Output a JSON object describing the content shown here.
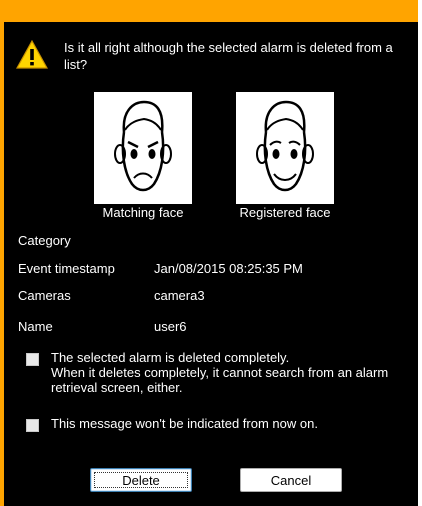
{
  "dialog": {
    "message": "Is it all right although the selected alarm is deleted from a list?"
  },
  "faces": {
    "matching_caption": "Matching face",
    "registered_caption": "Registered face"
  },
  "details": [
    {
      "label": "Category",
      "value": ""
    },
    {
      "label": "Event timestamp",
      "value": "Jan/08/2015 08:25:35 PM"
    },
    {
      "label": "Cameras",
      "value": "camera3"
    },
    {
      "label": "Name",
      "value": "user6"
    }
  ],
  "options": {
    "delete_completely": "The selected alarm is deleted completely.\nWhen it deletes completely, it cannot search from an alarm retrieval screen, either.",
    "dont_show_again": "This message won't be indicated from now on."
  },
  "buttons": {
    "delete": "Delete",
    "cancel": "Cancel"
  },
  "colors": {
    "title_bar": "#ffa400",
    "background": "#000000",
    "text": "#ffffff"
  },
  "icons": [
    "warning-icon",
    "angry-face-icon",
    "smiling-face-icon",
    "checkbox-icon"
  ]
}
